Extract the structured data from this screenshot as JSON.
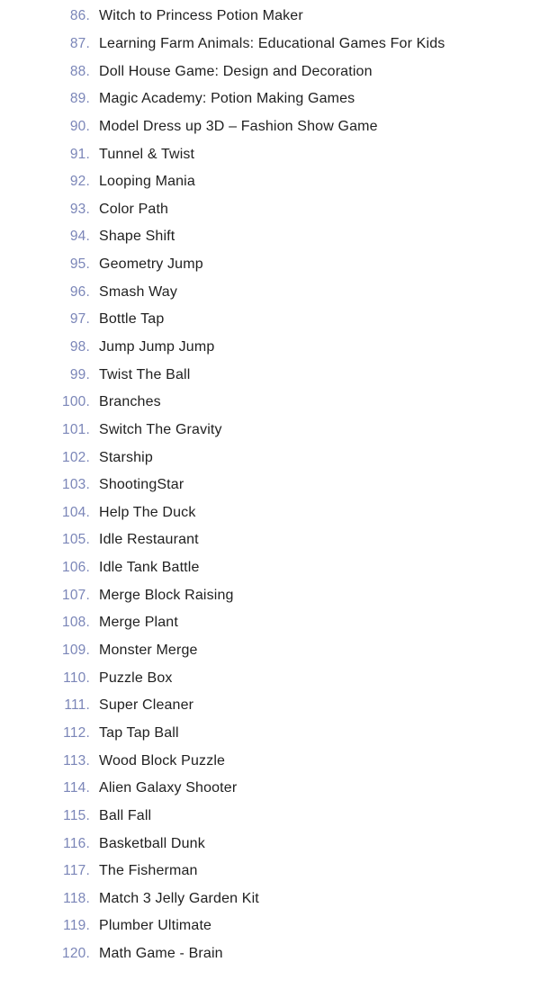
{
  "colors": {
    "number": "#7b86b8",
    "text": "#1f1f1f",
    "background": "#ffffff"
  },
  "list": {
    "items": [
      {
        "number": "86.",
        "title": "Witch to Princess Potion Maker"
      },
      {
        "number": "87.",
        "title": "Learning Farm Animals: Educational Games For Kids"
      },
      {
        "number": "88.",
        "title": "Doll House Game: Design and Decoration"
      },
      {
        "number": "89.",
        "title": "Magic Academy: Potion Making Games"
      },
      {
        "number": "90.",
        "title": "Model Dress up 3D – Fashion Show Game"
      },
      {
        "number": "91.",
        "title": "Tunnel & Twist"
      },
      {
        "number": "92.",
        "title": "Looping Mania"
      },
      {
        "number": "93.",
        "title": "Color Path"
      },
      {
        "number": "94.",
        "title": "Shape Shift"
      },
      {
        "number": "95.",
        "title": "Geometry Jump"
      },
      {
        "number": "96.",
        "title": "Smash Way"
      },
      {
        "number": "97.",
        "title": "Bottle Tap"
      },
      {
        "number": "98.",
        "title": "Jump Jump Jump"
      },
      {
        "number": "99.",
        "title": "Twist The Ball"
      },
      {
        "number": "100.",
        "title": "Branches"
      },
      {
        "number": "101.",
        "title": "Switch The Gravity"
      },
      {
        "number": "102.",
        "title": "Starship"
      },
      {
        "number": "103.",
        "title": "ShootingStar"
      },
      {
        "number": "104.",
        "title": "Help The Duck"
      },
      {
        "number": "105.",
        "title": "Idle Restaurant"
      },
      {
        "number": "106.",
        "title": "Idle Tank Battle"
      },
      {
        "number": "107.",
        "title": "Merge Block Raising"
      },
      {
        "number": "108.",
        "title": "Merge Plant"
      },
      {
        "number": "109.",
        "title": "Monster Merge"
      },
      {
        "number": "110.",
        "title": "Puzzle Box"
      },
      {
        "number": "111.",
        "title": "Super Cleaner"
      },
      {
        "number": "112.",
        "title": "Tap Tap Ball"
      },
      {
        "number": "113.",
        "title": "Wood Block Puzzle"
      },
      {
        "number": "114.",
        "title": "Alien Galaxy Shooter"
      },
      {
        "number": "115.",
        "title": "Ball Fall"
      },
      {
        "number": "116.",
        "title": "Basketball Dunk"
      },
      {
        "number": "117.",
        "title": "The Fisherman"
      },
      {
        "number": "118.",
        "title": "Match 3 Jelly Garden Kit"
      },
      {
        "number": "119.",
        "title": "Plumber Ultimate"
      },
      {
        "number": "120.",
        "title": "Math Game - Brain"
      }
    ]
  }
}
